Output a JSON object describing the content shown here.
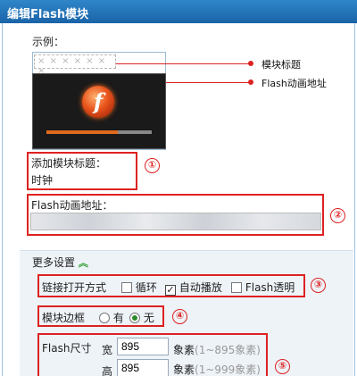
{
  "window": {
    "title": "编辑Flash模块"
  },
  "preview": {
    "sample_label": "示例：",
    "title_placeholder": "× × × × × × ×",
    "flash_letter": "f"
  },
  "callouts": {
    "module_title": "模块标题",
    "flash_address": "Flash动画地址"
  },
  "markers": [
    "①",
    "②",
    "③",
    "④",
    "⑤"
  ],
  "fields": {
    "add_title_label": "添加模块标题：",
    "add_title_value": "时钟",
    "flash_address_label": "Flash动画地址："
  },
  "more": {
    "label": "更多设置",
    "chevron": "︽",
    "link_open_label": "链接打开方式",
    "loop_label": "循环",
    "loop_checked": false,
    "autoplay_label": "自动播放",
    "autoplay_checked": true,
    "transparent_label": "Flash透明",
    "transparent_checked": false,
    "border_label": "模块边框",
    "border_yes": "有",
    "border_no": "无",
    "border_selected": "无",
    "size_label": "Flash尺寸",
    "width_label": "宽",
    "width_value": "895",
    "width_unit": "象素",
    "width_hint": "(1~895象素)",
    "height_label": "高",
    "height_value": "895",
    "height_unit": "象素",
    "height_hint": "(1~999象素)"
  },
  "colors": {
    "accent": "#1a63a8",
    "annotation": "#dd2222",
    "checked_radio": "#2a8a2a"
  }
}
